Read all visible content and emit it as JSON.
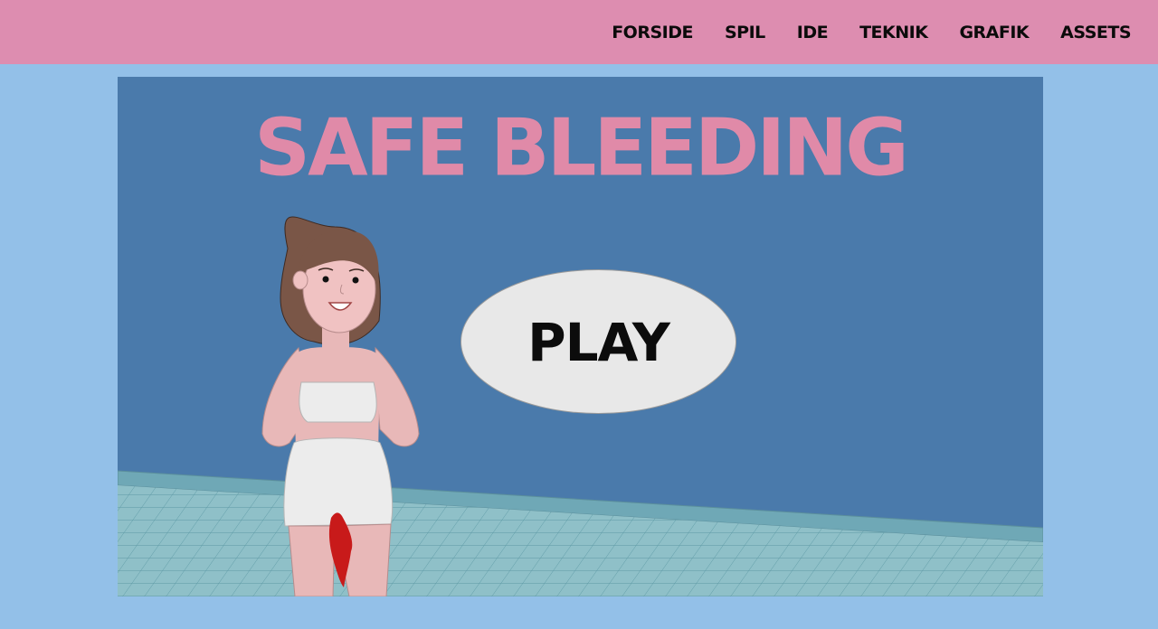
{
  "nav": {
    "items": [
      {
        "label": "FORSIDE"
      },
      {
        "label": "SPIL"
      },
      {
        "label": "IDE"
      },
      {
        "label": "TEKNIK"
      },
      {
        "label": "GRAFIK"
      },
      {
        "label": "ASSETS"
      }
    ]
  },
  "game": {
    "title": "SAFE BLEEDING",
    "play_label": "PLAY"
  },
  "colors": {
    "topbar": "#dd8db0",
    "page_background": "#93c0e8",
    "game_wall": "#4a7aab",
    "title": "#e08aa8",
    "pool_tiles": "#8fc0c8"
  }
}
